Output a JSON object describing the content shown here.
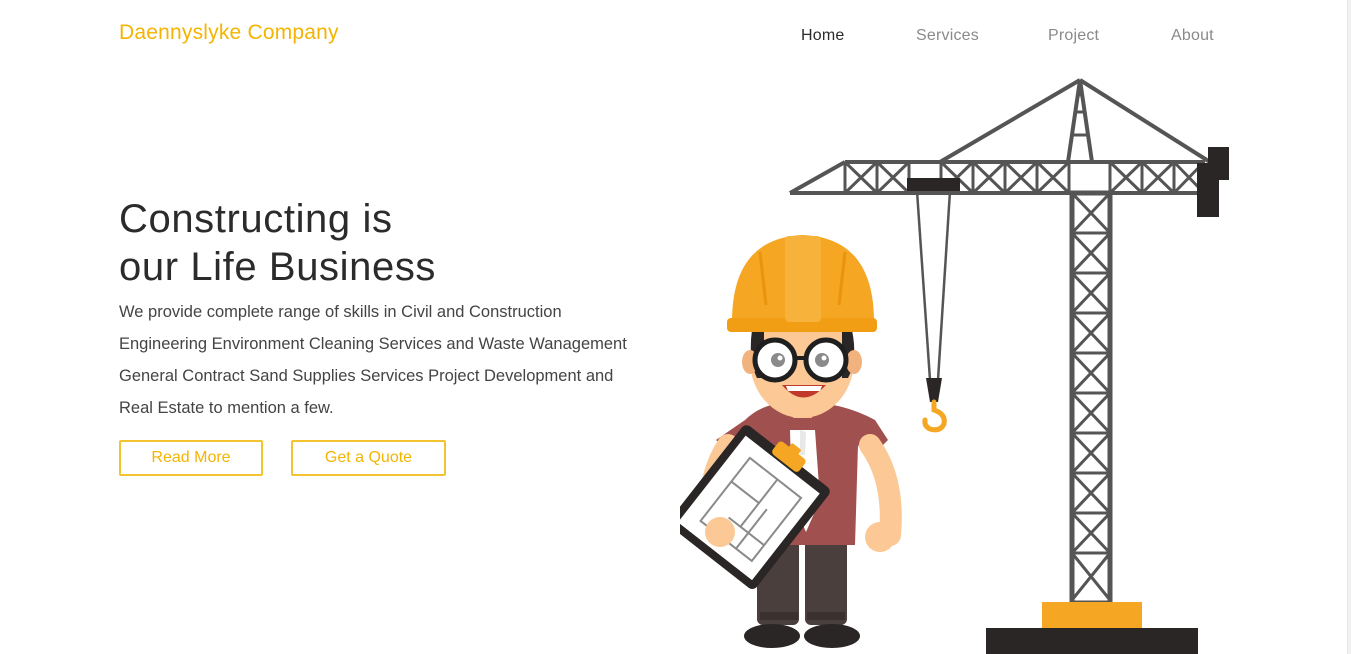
{
  "header": {
    "brand": "Daennyslyke Company"
  },
  "nav": {
    "items": [
      {
        "label": "Home",
        "active": true
      },
      {
        "label": "Services",
        "active": false
      },
      {
        "label": "Project",
        "active": false
      },
      {
        "label": "About",
        "active": false
      }
    ]
  },
  "hero": {
    "title_line1": "Constructing is",
    "title_line2": "our Life Business",
    "description": "We provide complete range of skills in Civil and Construction Engineering Environment Cleaning Services and Waste Wanagement General Contract Sand Supplies Services Project Development and Real Estate to mention a few.",
    "buttons": {
      "read_more": "Read More",
      "get_quote": "Get a Quote"
    }
  },
  "colors": {
    "accent": "#f4b400",
    "button_border": "#f4c430",
    "nav_active": "#2a2a2a",
    "nav_inactive": "#8a8a8a",
    "helmet": "#f5a623",
    "crane": "#555555",
    "crane_dark": "#2b2626"
  },
  "illustration": {
    "icons": [
      "construction-worker-illustration",
      "tower-crane-illustration",
      "crane-hook-icon",
      "blueprint-clipboard-icon",
      "hard-hat-icon"
    ]
  }
}
